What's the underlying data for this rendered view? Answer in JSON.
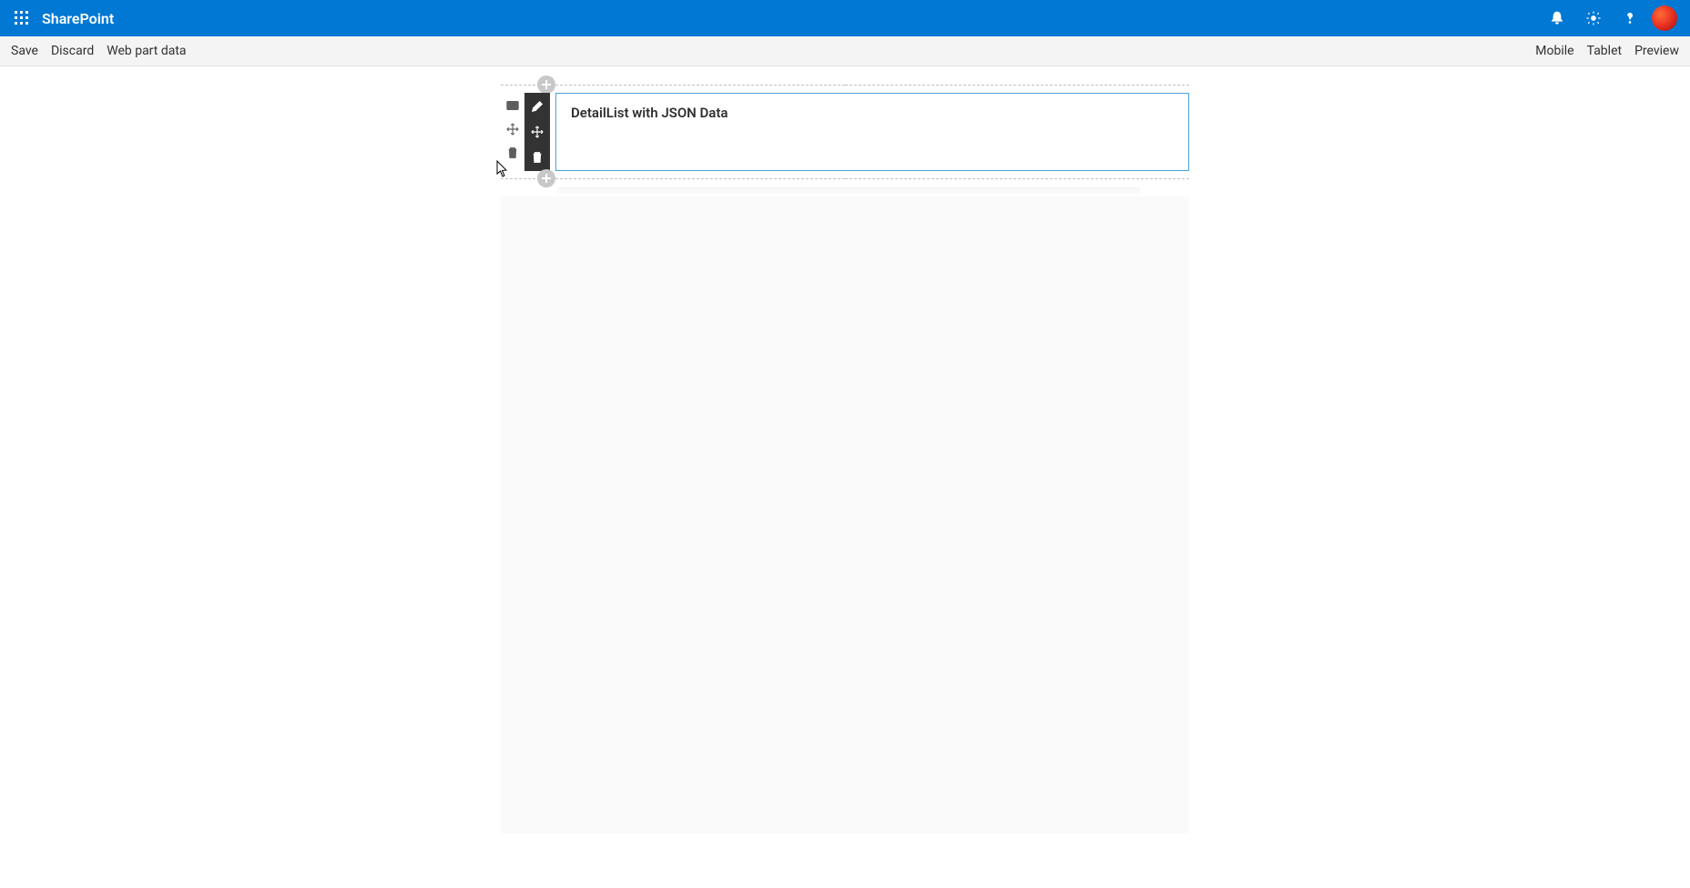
{
  "header": {
    "brand": "SharePoint"
  },
  "commandBar": {
    "left": [
      "Save",
      "Discard",
      "Web part data"
    ],
    "right": [
      "Mobile",
      "Tablet",
      "Preview"
    ]
  },
  "webpart": {
    "title": "DetailList with JSON Data"
  }
}
